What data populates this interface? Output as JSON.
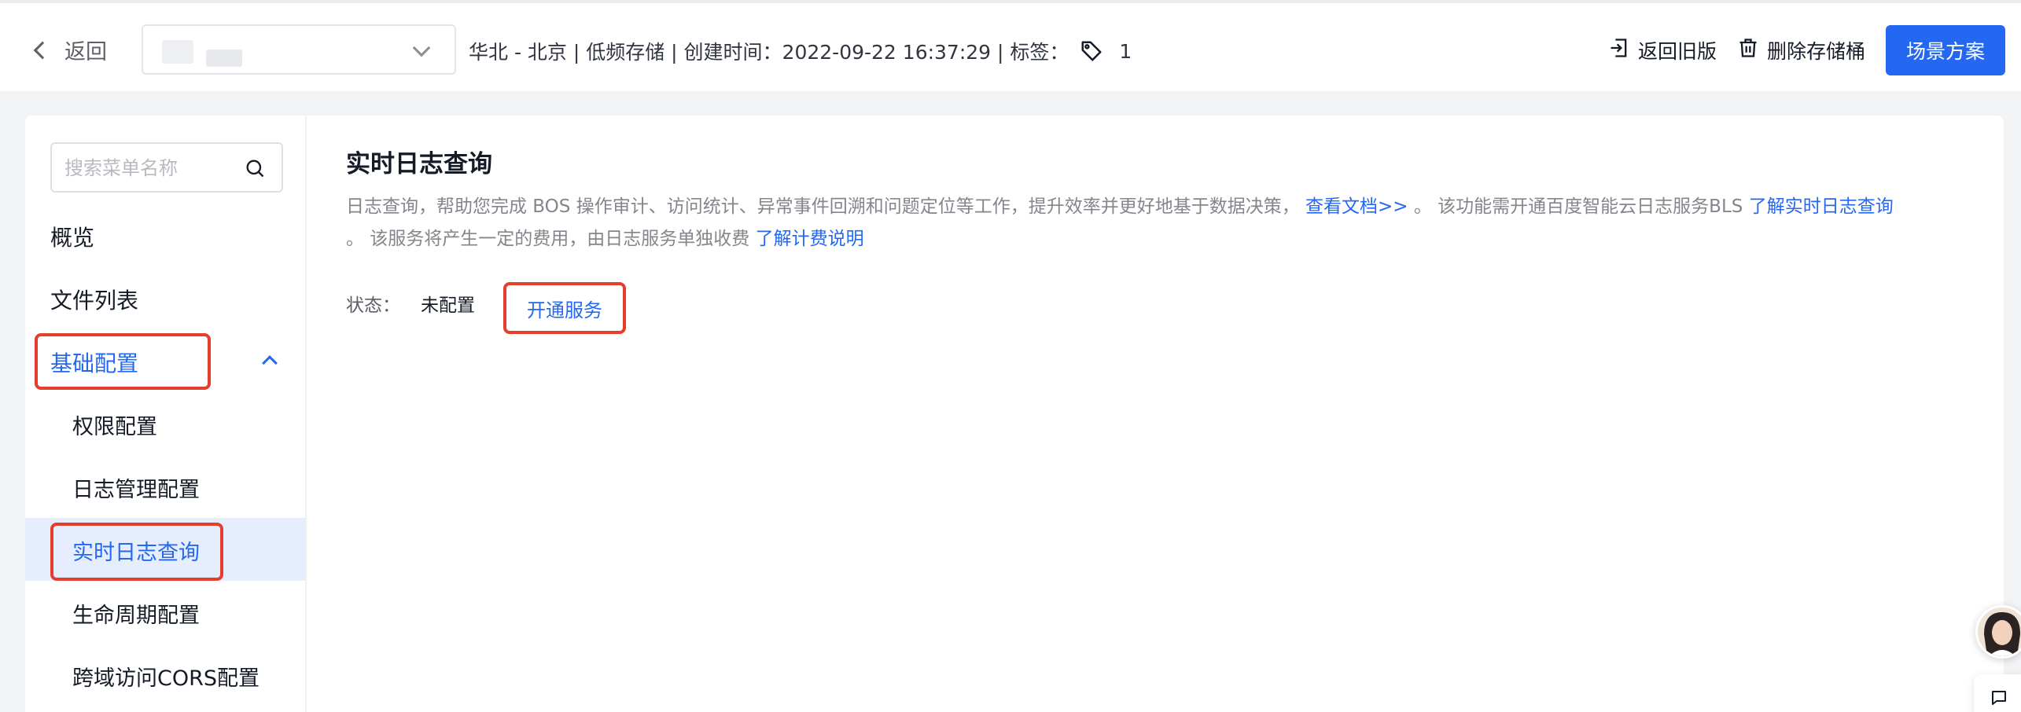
{
  "header": {
    "back_label": "返回",
    "bucket_meta": "华北 - 北京 | 低频存储 | 创建时间：2022-09-22 16:37:29 | 标签：",
    "tag_count": "1",
    "actions": {
      "old_version": "返回旧版",
      "delete_bucket": "删除存储桶",
      "scenario": "场景方案"
    }
  },
  "sidebar": {
    "search_placeholder": "搜索菜单名称",
    "items": {
      "overview": "概览",
      "file_list": "文件列表",
      "basic_config": "基础配置"
    },
    "sub_items": {
      "permission": "权限配置",
      "log_mgmt": "日志管理配置",
      "realtime_log": "实时日志查询",
      "lifecycle": "生命周期配置",
      "cors": "跨域访问CORS配置"
    }
  },
  "content": {
    "title": "实时日志查询",
    "desc_part1": "日志查询，帮助您完成 BOS 操作审计、访问统计、异常事件回溯和问题定位等工作，提升效率并更好地基于数据决策，",
    "link_docs": "查看文档>>",
    "desc_part2": " 。 该功能需开通百度智能云日志服务BLS ",
    "link_realtime": "了解实时日志查询",
    "desc_part3": "。 该服务将产生一定的费用，由日志服务单独收费 ",
    "link_billing": "了解计费说明",
    "status_label": "状态：",
    "status_value": "未配置",
    "open_button": "开通服务"
  },
  "colors": {
    "primary": "#2468f2",
    "highlight_box": "#e53e2b",
    "selected_bg": "#e6eefe"
  }
}
